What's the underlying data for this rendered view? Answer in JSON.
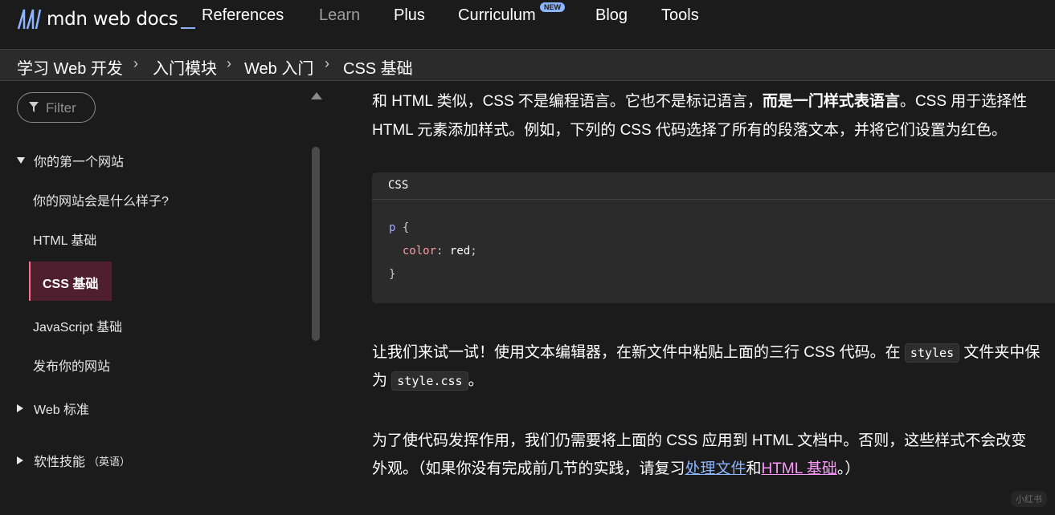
{
  "header": {
    "logo_text": "mdn web docs",
    "nav": [
      "References",
      "Learn",
      "Plus",
      "Curriculum",
      "Blog",
      "Tools"
    ],
    "new_badge": "NEW",
    "accent": "#8cb4ff"
  },
  "breadcrumb": [
    "学习 Web 开发",
    "入门模块",
    "Web 入门",
    "CSS 基础"
  ],
  "sidebar": {
    "filter_placeholder": "Filter",
    "group1": "你的第一个网站",
    "items": [
      "你的网站会是什么样子?",
      "HTML 基础",
      "CSS 基础",
      "JavaScript 基础",
      "发布你的网站"
    ],
    "group2": "Web 标准",
    "group3": "软性技能",
    "group3_note": "（英语）",
    "active_color": "#ff6b8b"
  },
  "main": {
    "p1_a": "和 HTML 类似，CSS 不是编程语言。它也不是标记语言，",
    "p1_bold": "而是一门样式表语言",
    "p1_b": "。CSS 用于选择性",
    "p1_line2": "HTML 元素添加样式。例如，下列的 CSS 代码选择了所有的段落文本，并将它们设置为红色。",
    "code_lang": "CSS",
    "code_selector": "p",
    "code_open": "{",
    "code_prop": "color",
    "code_colon": ":",
    "code_val": "red",
    "code_semicolon": ";",
    "code_close": "}",
    "p2_a": "让我们来试一试！使用文本编辑器，在新文件中粘贴上面的三行 CSS 代码。在",
    "p2_code1": "styles",
    "p2_b": "文件夹中保",
    "p2_line2_a": "为",
    "p2_code2": "style.css",
    "p2_line2_b": "。",
    "p3_line1": "为了使代码发挥作用，我们仍需要将上面的 CSS 应用到 HTML 文档中。否则，这些样式不会改变",
    "p3_line2_a": "外观。（如果你没有完成前几节的实践，请复习",
    "p3_link1": "处理文件",
    "p3_line2_b": "和",
    "p3_link2": "HTML 基础",
    "p3_line2_c": "。）"
  },
  "watermark": "小红书"
}
